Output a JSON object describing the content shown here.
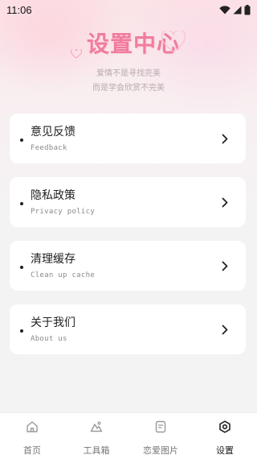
{
  "status_bar": {
    "time": "11:06"
  },
  "header": {
    "title": "设置中心",
    "subtitle_line1": "爱情不是寻找完美",
    "subtitle_line2": "而是学会欣赏不完美"
  },
  "menu": {
    "items": [
      {
        "label": "意见反馈",
        "sublabel": "Feedback"
      },
      {
        "label": "隐私政策",
        "sublabel": "Privacy policy"
      },
      {
        "label": "清理缓存",
        "sublabel": "Clean up cache"
      },
      {
        "label": "关于我们",
        "sublabel": "About us"
      }
    ]
  },
  "tabbar": {
    "tabs": [
      {
        "label": "首页",
        "icon": "home-icon"
      },
      {
        "label": "工具箱",
        "icon": "toolbox-icon"
      },
      {
        "label": "恋爱图片",
        "icon": "image-icon"
      },
      {
        "label": "设置",
        "icon": "settings-icon"
      }
    ],
    "active_index": 3
  },
  "colors": {
    "title_pink": "#f07c9e",
    "subtitle_gray": "#b9a9ad",
    "background": "#f4f3f4"
  }
}
